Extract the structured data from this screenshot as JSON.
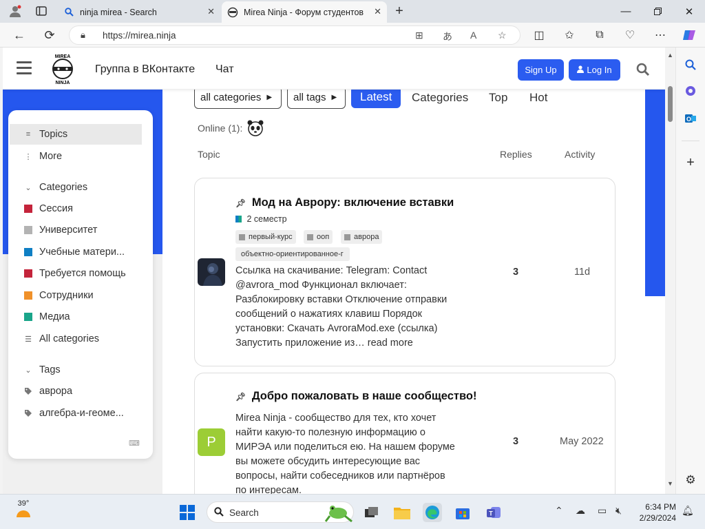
{
  "browser": {
    "tabs": [
      {
        "title": "ninja mirea - Search"
      },
      {
        "title": "Mirea Ninja - Форум студентов"
      }
    ],
    "url": "https://mirea.ninja"
  },
  "header": {
    "link_vk": "Группа в ВКонтакте",
    "link_chat": "Чат",
    "signup": "Sign Up",
    "login": "Log In"
  },
  "sidebar": {
    "topics": "Topics",
    "more": "More",
    "categories_heading": "Categories",
    "categories": [
      {
        "label": "Сессия",
        "color": "#c4243b"
      },
      {
        "label": "Университет",
        "color": "#b3b3b3"
      },
      {
        "label": "Учебные матери...",
        "color": "#0f7fc4"
      },
      {
        "label": "Требуется помощь",
        "color": "#c4243b"
      },
      {
        "label": "Сотрудники",
        "color": "#f0912a"
      },
      {
        "label": "Медиа",
        "color": "#1aa58a"
      }
    ],
    "all_categories": "All categories",
    "tags_heading": "Tags",
    "tags": [
      "аврора",
      "алгебра-и-геоме..."
    ]
  },
  "filters": {
    "all_categories": "all categories",
    "all_tags": "all tags",
    "latest": "Latest",
    "categories": "Categories",
    "top": "Top",
    "hot": "Hot",
    "online": "Online (1):"
  },
  "columns": {
    "topic": "Topic",
    "replies": "Replies",
    "activity": "Activity"
  },
  "topics": [
    {
      "title": "Мод на Аврору: включение вставки",
      "category": "2 семестр",
      "tags": [
        "первый-курс",
        "ооп",
        "аврора",
        "объектно-ориентированное-г"
      ],
      "excerpt_lines": [
        "Ссылка на скачивание: Telegram: Contact",
        "@avrora_mod Функционал включает:",
        "Разблокировку вставки Отключение отправки",
        "сообщений о нажатиях клавиш Порядок",
        "установки: Скачать AvroraMod.exe (ссылка)",
        "Запустить приложение из… read more"
      ],
      "replies": "3",
      "activity": "11d"
    },
    {
      "title": "Добро пожаловать в наше сообщество!",
      "avatar_letter": "P",
      "excerpt_lines": [
        "Mirea Ninja - сообщество для тех, кто хочет",
        "найти какую-то полезную информацию о",
        "МИРЭА или поделиться ею. На нашем форуме",
        "вы можете обсудить интересующие вас",
        "вопросы, найти собеседников или партнёров",
        "по интересам."
      ],
      "replies": "3",
      "activity": "May 2022"
    }
  ],
  "taskbar": {
    "weather": "39°",
    "search": "Search",
    "time": "6:34 PM",
    "date": "2/29/2024"
  }
}
